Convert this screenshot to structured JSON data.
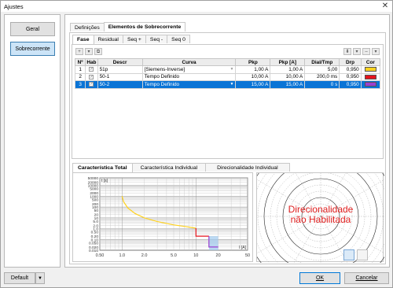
{
  "window": {
    "title": "Ajustes"
  },
  "sidebar": {
    "items": [
      {
        "label": "Geral"
      },
      {
        "label": "Sobrecorrente"
      }
    ]
  },
  "main_tabs": [
    {
      "label": "Definições"
    },
    {
      "label": "Elementos de Sobrecorrente"
    }
  ],
  "sub_tabs": [
    {
      "label": "Fase"
    },
    {
      "label": "Residual"
    },
    {
      "label": "Seq +"
    },
    {
      "label": "Seq -"
    },
    {
      "label": "Seq 0"
    }
  ],
  "table": {
    "headers": [
      "Nº",
      "Hab",
      "Descr",
      "Curva",
      "Pkp",
      "Pkp [A]",
      "Dial/Tmp",
      "Drp",
      "Cor"
    ],
    "rows": [
      {
        "n": "1",
        "descr": "51p",
        "curva": "[Siemens-Inverse]",
        "pkp": "1,00 A",
        "pkpa": "1,00 A",
        "dial": "5,00",
        "drp": "0,950",
        "color": "#ffd21f"
      },
      {
        "n": "2",
        "descr": "50-1",
        "curva": "Tempo Definido",
        "pkp": "10,00 A",
        "pkpa": "10,00 A",
        "dial": "200,0 ms",
        "drp": "0,950",
        "color": "#e5141c"
      },
      {
        "n": "3",
        "descr": "50-2",
        "curva": "Tempo Definido",
        "pkp": "15,00 A",
        "pkpa": "15,00 A",
        "dial": "0 s",
        "drp": "0,950",
        "color": "#9b3fcf"
      }
    ]
  },
  "chart_tabs": [
    {
      "label": "Característica Total"
    },
    {
      "label": "Característica Individual"
    },
    {
      "label": "Direcionalidade Individual"
    }
  ],
  "chart": {
    "ylabel": "t [s]",
    "xlabel": "I [A]",
    "x_ticks": [
      "0.50",
      "1.0",
      "2.0",
      "5.0",
      "10",
      "20",
      "50"
    ],
    "y_ticks": [
      "50000",
      "20000",
      "10000",
      "5000",
      "2000",
      "1000",
      "500",
      "200",
      "100",
      "50",
      "20",
      "10",
      "5.0",
      "2.0",
      "1.0",
      "0.50",
      "0.20",
      "0.10",
      "0.050",
      "0.020",
      "0.010"
    ]
  },
  "chart_data": {
    "type": "line",
    "xlabel": "I [A]",
    "ylabel": "t [s]",
    "x_scale": "log",
    "y_scale": "log",
    "xlim": [
      0.5,
      50
    ],
    "ylim": [
      0.01,
      50000
    ],
    "series": [
      {
        "color": "#ffd21f",
        "x": [
          1.0,
          1.05,
          1.2,
          1.5,
          2,
          3,
          5,
          7,
          10
        ],
        "y": [
          1000,
          300,
          80,
          25,
          10,
          4.5,
          2.2,
          1.6,
          1.1
        ]
      },
      {
        "color": "#e5141c",
        "x": [
          10,
          10,
          15
        ],
        "y": [
          1.1,
          0.2,
          0.2
        ]
      },
      {
        "color": "#9b3fcf",
        "x": [
          15,
          15,
          20
        ],
        "y": [
          0.2,
          0.02,
          0.02
        ]
      }
    ]
  },
  "direction": {
    "text1": "Direcionalidade",
    "text2": "não Habilitada"
  },
  "footer": {
    "default_label": "Default",
    "ok_label": "OK",
    "cancel_label": "Cancelar"
  }
}
